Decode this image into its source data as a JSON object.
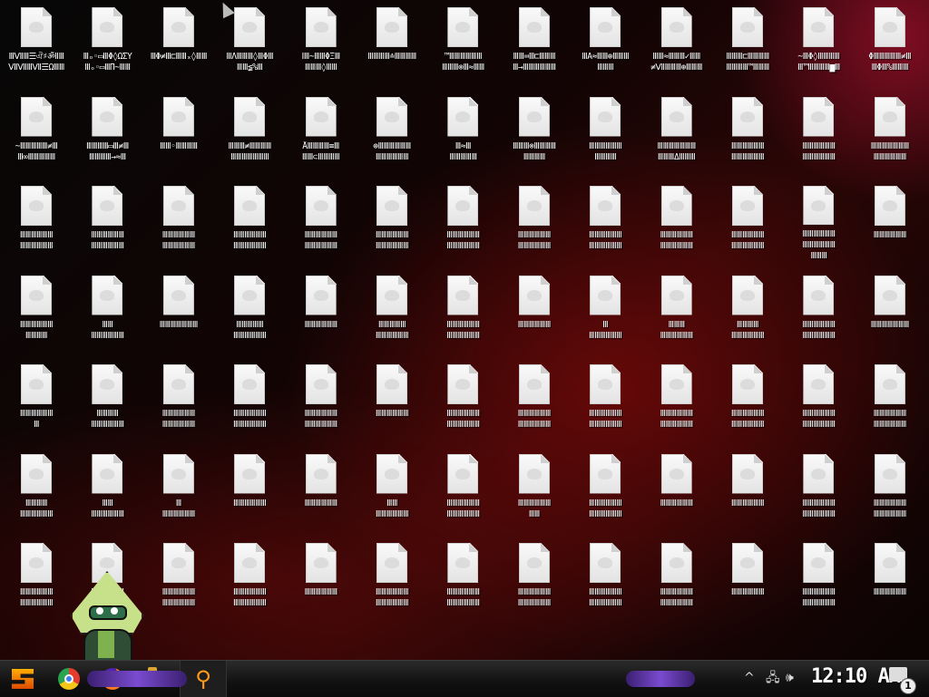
{
  "desktop": {
    "icon_image": "generic-file-icon",
    "rows": [
      [
        {
          "label": "ⅢⅦⅢ☰ঐ♯ॐⅡⅢ\nⅦⅦⅢⅦ☰ΩⅢⅢ"
        },
        {
          "label": "Ⅲₒ◦▭ⅢΦ◊ΩΣΥ\nⅢₒ◦▭ⅢΠ~ⅢⅢ"
        },
        {
          "label": "ⅢΦ≠Ⅲ⊏ⅢⅢₓ◊ⅢⅢ"
        },
        {
          "label": "ⅢΛⅢⅢⅢ◊ⅢΦⅢ\nⅢⅢ≨%Ⅲ"
        },
        {
          "label": "ⅠⅢ~ⅢⅢΦΞⅢ\nⅢⅢⅢ◊ⅢⅢ"
        },
        {
          "label": "ⅢⅢⅢⅢ≐ⅢⅢⅢⅢ"
        },
        {
          "label": "™ⅢⅢⅢⅢⅢⅢ\nⅢⅢⅢ⊗Ⅲ≈ⅢⅢ"
        },
        {
          "label": "ⅢⅢ≕Ⅲ⊏ⅢⅢⅢ\nⅢ→ⅢⅢⅢⅢⅢⅢ"
        },
        {
          "label": "ⅢΑ≈ⅢⅢ⊕ⅢⅢⅢ\nⅢⅢⅢ"
        },
        {
          "label": "ⅢⅢ≈ⅢⅢⅢ✓ⅢⅢ\n≠ⅦⅢⅢⅢ⊕ⅢⅢⅢ"
        },
        {
          "label": "ⅢⅢⅢ⊏ⅢⅢⅢⅢ\nⅢⅢⅢⅢ™ⅢⅢⅢ"
        },
        {
          "label": "~ⅢΦ◊ⅢⅢⅢⅢ\nⅢ™ⅢⅢⅢⅢ▆Ⅲ"
        },
        {
          "label": "ΦⅢⅢⅢⅢⅢ≠Ⅲ\nⅢΦⅢ%ⅢⅢⅢ"
        }
      ],
      [
        {
          "label": "~ⅢⅢⅢⅢⅢ≠Ⅲ\nⅢ∞ⅢⅢⅢⅢⅢ"
        },
        {
          "label": "ⅢⅢⅢⅢ▭Ⅲ≠Ⅲ\nⅢⅢⅢⅢ→≈Ⅲ"
        },
        {
          "label": "ⅢⅢ◦ⅢⅢⅢⅢ"
        },
        {
          "label": "ⅢⅢⅢ≠ⅢⅢⅢⅢ\nⅢⅢⅢⅢⅢⅢⅢ"
        },
        {
          "label": "ÅⅢⅢⅢⅢ≡Ⅲ\nⅢⅢ⊂ⅢⅢⅢⅢ"
        },
        {
          "label": "⊕ⅢⅢⅢⅢⅢⅢ\nⅢⅢⅢⅢⅢⅢ"
        },
        {
          "label": "Ⅲ≈Ⅲ\nⅢⅢⅢⅢⅢ"
        },
        {
          "label": "ⅢⅢⅢ⊗ⅢⅢⅢⅢ\nⅢⅢⅢⅢ"
        },
        {
          "label": "ⅢⅢⅢⅢⅢⅢ\nⅢⅢⅢⅢ"
        },
        {
          "label": "ⅢⅢⅢⅢⅢⅢⅢ\nⅢⅢⅢΔⅢⅢⅢ"
        },
        {
          "label": "ⅢⅢⅢⅢⅢⅢ\nⅢⅢⅢⅢⅢⅢ"
        },
        {
          "label": "ⅢⅢⅢⅢⅢⅢ\nⅢⅢⅢⅢⅢⅢ"
        },
        {
          "label": "ⅢⅢⅢⅢⅢⅢⅢ\nⅢⅢⅢⅢⅢⅢ"
        }
      ],
      [
        {
          "label": "ⅢⅢⅢⅢⅢⅢ\nⅢⅢⅢⅢⅢⅢ"
        },
        {
          "label": "ⅢⅢⅢⅢⅢⅢ\nⅢⅢⅢⅢⅢⅢ"
        },
        {
          "label": "ⅢⅢⅢⅢⅢⅢ\nⅢⅢⅢⅢⅢⅢ"
        },
        {
          "label": "ⅢⅢⅢⅢⅢⅢ\nⅢⅢⅢⅢⅢⅢ"
        },
        {
          "label": "ⅢⅢⅢⅢⅢⅢ\nⅢⅢⅢⅢⅢⅢ"
        },
        {
          "label": "ⅢⅢⅢⅢⅢⅢ\nⅢⅢⅢⅢⅢⅢ"
        },
        {
          "label": "ⅢⅢⅢⅢⅢⅢ\nⅢⅢⅢⅢⅢⅢ"
        },
        {
          "label": "ⅢⅢⅢⅢⅢⅢ\nⅢⅢⅢⅢⅢⅢ"
        },
        {
          "label": "ⅢⅢⅢⅢⅢⅢ\nⅢⅢⅢⅢⅢⅢ"
        },
        {
          "label": "ⅢⅢⅢⅢⅢⅢ\nⅢⅢⅢⅢⅢⅢ"
        },
        {
          "label": "ⅢⅢⅢⅢⅢⅢ\nⅢⅢⅢⅢⅢⅢ"
        },
        {
          "label": "ⅢⅢⅢⅢⅢⅢ\nⅢⅢⅢⅢⅢⅢ\nⅢⅢⅢ"
        },
        {
          "label": "ⅢⅢⅢⅢⅢⅢ"
        }
      ],
      [
        {
          "label": "ⅢⅢⅢⅢⅢⅢ\nⅢⅢⅢⅢ"
        },
        {
          "label": "ⅢⅢ\nⅢⅢⅢⅢⅢⅢ"
        },
        {
          "label": "ⅢⅢⅢⅢⅢⅢⅢ"
        },
        {
          "label": "ⅢⅢⅢⅢⅢ\nⅢⅢⅢⅢⅢⅢ"
        },
        {
          "label": "ⅢⅢⅢⅢⅢⅢ"
        },
        {
          "label": "ⅢⅢⅢⅢⅢ\nⅢⅢⅢⅢⅢⅢ"
        },
        {
          "label": "ⅢⅢⅢⅢⅢⅢ\nⅢⅢⅢⅢⅢⅢ"
        },
        {
          "label": "ⅢⅢⅢⅢⅢⅢ"
        },
        {
          "label": "Ⅲ\nⅢⅢⅢⅢⅢⅢ"
        },
        {
          "label": "ⅢⅢⅢ\nⅢⅢⅢⅢⅢⅢ"
        },
        {
          "label": "ⅢⅢⅢⅢ\nⅢⅢⅢⅢⅢⅢ"
        },
        {
          "label": "ⅢⅢⅢⅢⅢⅢ\nⅢⅢⅢⅢⅢⅢ"
        },
        {
          "label": "ⅢⅢⅢⅢⅢⅢⅢ"
        }
      ],
      [
        {
          "label": "ⅢⅢⅢⅢⅢⅢ\nⅢ"
        },
        {
          "label": "ⅢⅢⅢⅢ\nⅢⅢⅢⅢⅢⅢ"
        },
        {
          "label": "ⅢⅢⅢⅢⅢⅢ\nⅢⅢⅢⅢⅢⅢ"
        },
        {
          "label": "ⅢⅢⅢⅢⅢⅢ\nⅢⅢⅢⅢⅢⅢ"
        },
        {
          "label": "ⅢⅢⅢⅢⅢⅢ\nⅢⅢⅢⅢⅢⅢ"
        },
        {
          "label": "ⅢⅢⅢⅢⅢⅢ"
        },
        {
          "label": "ⅢⅢⅢⅢⅢⅢ\nⅢⅢⅢⅢⅢⅢ"
        },
        {
          "label": "ⅢⅢⅢⅢⅢⅢ\nⅢⅢⅢⅢⅢⅢ"
        },
        {
          "label": "ⅢⅢⅢⅢⅢⅢ\nⅢⅢⅢⅢⅢⅢ"
        },
        {
          "label": "ⅢⅢⅢⅢⅢⅢ\nⅢⅢⅢⅢⅢⅢ"
        },
        {
          "label": "ⅢⅢⅢⅢⅢⅢ\nⅢⅢⅢⅢⅢⅢ"
        },
        {
          "label": "ⅢⅢⅢⅢⅢⅢ\nⅢⅢⅢⅢⅢⅢ"
        },
        {
          "label": "ⅢⅢⅢⅢⅢⅢ\nⅢⅢⅢⅢⅢⅢ"
        }
      ],
      [
        {
          "label": "ⅢⅢⅢⅢ\nⅢⅢⅢⅢⅢⅢ"
        },
        {
          "label": "ⅢⅢ\nⅢⅢⅢⅢⅢⅢ"
        },
        {
          "label": "Ⅲ\nⅢⅢⅢⅢⅢⅢ"
        },
        {
          "label": "ⅢⅢⅢⅢⅢⅢ"
        },
        {
          "label": "ⅢⅢⅢⅢⅢⅢ"
        },
        {
          "label": "ⅢⅢ\nⅢⅢⅢⅢⅢⅢ"
        },
        {
          "label": "ⅢⅢⅢⅢⅢⅢ\nⅢⅢⅢⅢⅢⅢ"
        },
        {
          "label": "ⅢⅢⅢⅢⅢⅢ\nⅢⅢ"
        },
        {
          "label": "ⅢⅢⅢⅢⅢⅢ\nⅢⅢⅢⅢⅢⅢ"
        },
        {
          "label": "ⅢⅢⅢⅢⅢⅢ"
        },
        {
          "label": "ⅢⅢⅢⅢⅢⅢ"
        },
        {
          "label": "ⅢⅢⅢⅢⅢⅢ\nⅢⅢⅢⅢⅢⅢ"
        },
        {
          "label": "ⅢⅢⅢⅢⅢⅢ\nⅢⅢⅢⅢⅢⅢ"
        }
      ],
      [
        {
          "label": "ⅢⅢⅢⅢⅢⅢ\nⅢⅢⅢⅢⅢⅢ"
        },
        {
          "label": "ⅢⅢⅢⅢⅢⅢ\nⅢⅢⅢⅢⅢⅢ"
        },
        {
          "label": "ⅢⅢⅢⅢⅢⅢ\nⅢⅢⅢⅢⅢⅢ"
        },
        {
          "label": "ⅢⅢⅢⅢⅢⅢ\nⅢⅢⅢⅢⅢⅢ"
        },
        {
          "label": "ⅢⅢⅢⅢⅢⅢ"
        },
        {
          "label": "ⅢⅢⅢⅢⅢⅢ\nⅢⅢⅢⅢⅢⅢ"
        },
        {
          "label": "ⅢⅢⅢⅢⅢⅢ\nⅢⅢⅢⅢⅢⅢ"
        },
        {
          "label": "ⅢⅢⅢⅢⅢⅢ\nⅢⅢⅢⅢⅢⅢ"
        },
        {
          "label": "ⅢⅢⅢⅢⅢⅢ\nⅢⅢⅢⅢⅢⅢ"
        },
        {
          "label": "ⅢⅢⅢⅢⅢⅢ\nⅢⅢⅢⅢⅢⅢ"
        },
        {
          "label": "ⅢⅢⅢⅢⅢⅢ"
        },
        {
          "label": "ⅢⅢⅢⅢⅢⅢ\nⅢⅢⅢⅢⅢⅢ"
        },
        {
          "label": "ⅢⅢⅢⅢⅢⅢ"
        }
      ]
    ]
  },
  "taskbar": {
    "start_icon": "start-logo-icon",
    "pinned": [
      {
        "name": "chrome",
        "icon": "chrome-icon"
      },
      {
        "name": "firefox",
        "icon": "firefox-icon"
      },
      {
        "name": "file-explorer",
        "icon": "folder-icon"
      }
    ],
    "search_glyph": "⚲",
    "tray": {
      "chevron": "^",
      "network_icon": "network-icon",
      "volume_icon": "volume-icon",
      "volume_glyph": "🕪",
      "network_glyph": "🖧",
      "clock": "12:10 AM",
      "notification_count": "1"
    }
  },
  "colors": {
    "accent_orange": "#ff9a1a",
    "accent_purple": "#7a4bd0",
    "wallpaper_red": "#8a0a0a"
  }
}
